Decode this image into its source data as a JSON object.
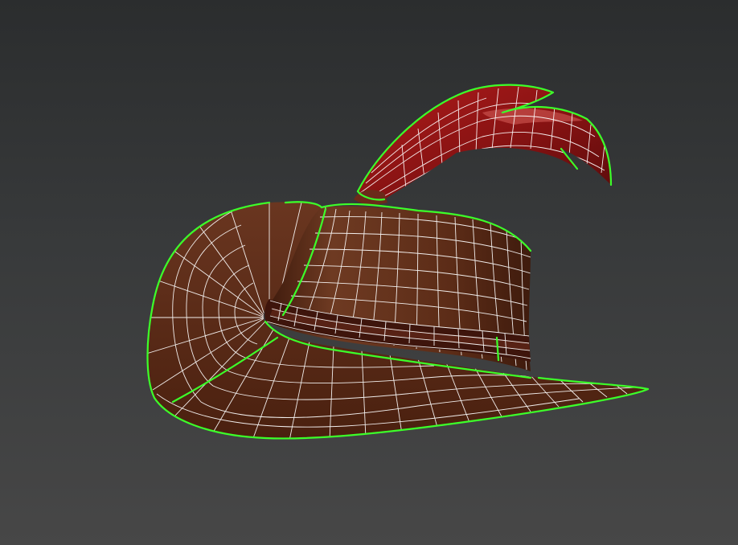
{
  "viewport": {
    "background_top": "#2b2d2e",
    "background_bottom": "#474747"
  },
  "model": {
    "object": "hat",
    "selection_color": "#3cff2a",
    "wireframe_color": "#ffffff",
    "hat_color": "#5e2c18",
    "hat_shadow_color": "#3a170b",
    "band_color": "#4a1a10",
    "feather_color": "#8e1414",
    "feather_highlight": "#c23a36"
  }
}
